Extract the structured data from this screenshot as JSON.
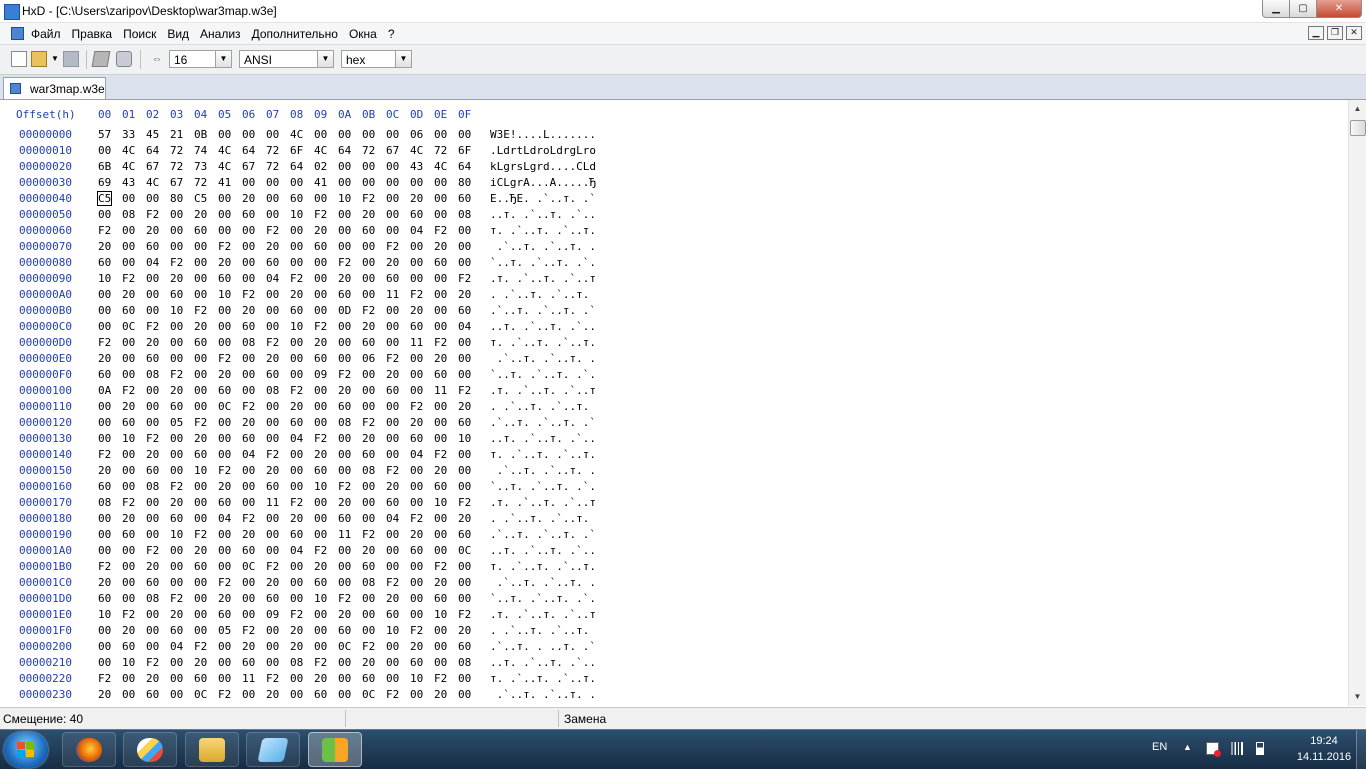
{
  "window": {
    "title": "HxD - [C:\\Users\\zaripov\\Desktop\\war3map.w3e]",
    "app_icon_text": "HxD",
    "controls": {
      "minimize": "▁",
      "maximize": "▢",
      "close": "✕"
    }
  },
  "menu": {
    "items": [
      "Файл",
      "Правка",
      "Поиск",
      "Вид",
      "Анализ",
      "Дополнительно",
      "Окна",
      "?"
    ],
    "mdi": {
      "minimize": "▁",
      "restore": "❐",
      "close": "✕"
    }
  },
  "toolbar": {
    "icons": [
      "new-file-icon",
      "open-file-icon",
      "save-icon",
      "open-ram-icon",
      "open-disk-icon",
      "bytes-per-row-icon"
    ],
    "bytes_per_row": "16",
    "charset": "ANSI",
    "offset_base": "hex",
    "arrow": "▼"
  },
  "tabs": [
    {
      "label": "war3map.w3e",
      "icon": "hex-document-icon"
    }
  ],
  "editor": {
    "header_offset": "Offset(h)",
    "header_cols": [
      "00",
      "01",
      "02",
      "03",
      "04",
      "05",
      "06",
      "07",
      "08",
      "09",
      "0A",
      "0B",
      "0C",
      "0D",
      "0E",
      "0F"
    ],
    "caret_row": 4,
    "caret_col": 0,
    "rows": [
      {
        "offset": "00000000",
        "bytes": "57 33 45 21 0B 00 00 00 4C 00 00 00 00 06 00 00",
        "text": "W3E!....L......."
      },
      {
        "offset": "00000010",
        "bytes": "00 4C 64 72 74 4C 64 72 6F 4C 64 72 67 4C 72 6F",
        "text": ".LdrtLdroLdrgLro"
      },
      {
        "offset": "00000020",
        "bytes": "6B 4C 67 72 73 4C 67 72 64 02 00 00 00 43 4C 64",
        "text": "kLgrsLgrd....CLd"
      },
      {
        "offset": "00000030",
        "bytes": "69 43 4C 67 72 41 00 00 00 41 00 00 00 00 00 80",
        "text": "iCLgrA...A.....Ђ"
      },
      {
        "offset": "00000040",
        "bytes": "C5 00 00 80 C5 00 20 00 60 00 10 F2 00 20 00 60",
        "text": "Е..ЂЕ. .`..т. .`"
      },
      {
        "offset": "00000050",
        "bytes": "00 08 F2 00 20 00 60 00 10 F2 00 20 00 60 00 08",
        "text": "..т. .`..т. .`.."
      },
      {
        "offset": "00000060",
        "bytes": "F2 00 20 00 60 00 00 F2 00 20 00 60 00 04 F2 00",
        "text": "т. .`..т. .`..т."
      },
      {
        "offset": "00000070",
        "bytes": "20 00 60 00 00 F2 00 20 00 60 00 00 F2 00 20 00",
        "text": " .`..т. .`..т. ."
      },
      {
        "offset": "00000080",
        "bytes": "60 00 04 F2 00 20 00 60 00 00 F2 00 20 00 60 00",
        "text": "`..т. .`..т. .`."
      },
      {
        "offset": "00000090",
        "bytes": "10 F2 00 20 00 60 00 04 F2 00 20 00 60 00 00 F2",
        "text": ".т. .`..т. .`..т"
      },
      {
        "offset": "000000A0",
        "bytes": "00 20 00 60 00 10 F2 00 20 00 60 00 11 F2 00 20",
        "text": ". .`..т. .`..т. "
      },
      {
        "offset": "000000B0",
        "bytes": "00 60 00 10 F2 00 20 00 60 00 0D F2 00 20 00 60",
        "text": ".`..т. .`..т. .`"
      },
      {
        "offset": "000000C0",
        "bytes": "00 0C F2 00 20 00 60 00 10 F2 00 20 00 60 00 04",
        "text": "..т. .`..т. .`.."
      },
      {
        "offset": "000000D0",
        "bytes": "F2 00 20 00 60 00 08 F2 00 20 00 60 00 11 F2 00",
        "text": "т. .`..т. .`..т."
      },
      {
        "offset": "000000E0",
        "bytes": "20 00 60 00 00 F2 00 20 00 60 00 06 F2 00 20 00",
        "text": " .`..т. .`..т. ."
      },
      {
        "offset": "000000F0",
        "bytes": "60 00 08 F2 00 20 00 60 00 09 F2 00 20 00 60 00",
        "text": "`..т. .`..т. .`."
      },
      {
        "offset": "00000100",
        "bytes": "0A F2 00 20 00 60 00 08 F2 00 20 00 60 00 11 F2",
        "text": ".т. .`..т. .`..т"
      },
      {
        "offset": "00000110",
        "bytes": "00 20 00 60 00 0C F2 00 20 00 60 00 00 F2 00 20",
        "text": ". .`..т. .`..т. "
      },
      {
        "offset": "00000120",
        "bytes": "00 60 00 05 F2 00 20 00 60 00 08 F2 00 20 00 60",
        "text": ".`..т. .`..т. .`"
      },
      {
        "offset": "00000130",
        "bytes": "00 10 F2 00 20 00 60 00 04 F2 00 20 00 60 00 10",
        "text": "..т. .`..т. .`.."
      },
      {
        "offset": "00000140",
        "bytes": "F2 00 20 00 60 00 04 F2 00 20 00 60 00 04 F2 00",
        "text": "т. .`..т. .`..т."
      },
      {
        "offset": "00000150",
        "bytes": "20 00 60 00 10 F2 00 20 00 60 00 08 F2 00 20 00",
        "text": " .`..т. .`..т. ."
      },
      {
        "offset": "00000160",
        "bytes": "60 00 08 F2 00 20 00 60 00 10 F2 00 20 00 60 00",
        "text": "`..т. .`..т. .`."
      },
      {
        "offset": "00000170",
        "bytes": "08 F2 00 20 00 60 00 11 F2 00 20 00 60 00 10 F2",
        "text": ".т. .`..т. .`..т"
      },
      {
        "offset": "00000180",
        "bytes": "00 20 00 60 00 04 F2 00 20 00 60 00 04 F2 00 20",
        "text": ". .`..т. .`..т. "
      },
      {
        "offset": "00000190",
        "bytes": "00 60 00 10 F2 00 20 00 60 00 11 F2 00 20 00 60",
        "text": ".`..т. .`..т. .`"
      },
      {
        "offset": "000001A0",
        "bytes": "00 00 F2 00 20 00 60 00 04 F2 00 20 00 60 00 0C",
        "text": "..т. .`..т. .`.."
      },
      {
        "offset": "000001B0",
        "bytes": "F2 00 20 00 60 00 0C F2 00 20 00 60 00 00 F2 00",
        "text": "т. .`..т. .`..т."
      },
      {
        "offset": "000001C0",
        "bytes": "20 00 60 00 00 F2 00 20 00 60 00 08 F2 00 20 00",
        "text": " .`..т. .`..т. ."
      },
      {
        "offset": "000001D0",
        "bytes": "60 00 08 F2 00 20 00 60 00 10 F2 00 20 00 60 00",
        "text": "`..т. .`..т. .`."
      },
      {
        "offset": "000001E0",
        "bytes": "10 F2 00 20 00 60 00 09 F2 00 20 00 60 00 10 F2",
        "text": ".т. .`..т. .`..т"
      },
      {
        "offset": "000001F0",
        "bytes": "00 20 00 60 00 05 F2 00 20 00 60 00 10 F2 00 20",
        "text": ". .`..т. .`..т. "
      },
      {
        "offset": "00000200",
        "bytes": "00 60 00 04 F2 00 20 00 20 00 0C F2 00 20 00 60",
        "text": ".`..т. . ..т. .`"
      },
      {
        "offset": "00000210",
        "bytes": "00 10 F2 00 20 00 60 00 08 F2 00 20 00 60 00 08",
        "text": "..т. .`..т. .`.."
      },
      {
        "offset": "00000220",
        "bytes": "F2 00 20 00 60 00 11 F2 00 20 00 60 00 10 F2 00",
        "text": "т. .`..т. .`..т."
      },
      {
        "offset": "00000230",
        "bytes": "20 00 60 00 0C F2 00 20 00 60 00 0C F2 00 20 00",
        "text": " .`..т. .`..т. ."
      }
    ]
  },
  "statusbar": {
    "offset_label": "Смещение: 40",
    "mode": "Замена"
  },
  "taskbar": {
    "apps": [
      "firefox-icon",
      "paint-icon",
      "explorer-icon",
      "notepad-icon",
      "hxd-icon"
    ],
    "active_app": "hxd-icon",
    "language": "EN",
    "tray_arrow": "▲",
    "time": "19:24",
    "date": "14.11.2016"
  }
}
